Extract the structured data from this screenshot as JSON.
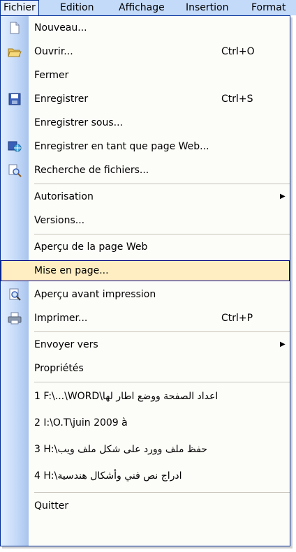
{
  "menubar": {
    "items": [
      {
        "label": "Fichier"
      },
      {
        "label": "Edition"
      },
      {
        "label": "Affichage"
      },
      {
        "label": "Insertion"
      },
      {
        "label": "Format"
      }
    ]
  },
  "menu": {
    "nouveau": {
      "label": "Nouveau...",
      "icon": "new-document-icon"
    },
    "ouvrir": {
      "label": "Ouvrir...",
      "shortcut": "Ctrl+O",
      "icon": "open-folder-icon"
    },
    "fermer": {
      "label": "Fermer"
    },
    "enregistrer": {
      "label": "Enregistrer",
      "shortcut": "Ctrl+S",
      "icon": "save-disk-icon"
    },
    "enregistrer_sous": {
      "label": "Enregistrer sous..."
    },
    "enregistrer_web": {
      "label": "Enregistrer en tant que page Web...",
      "icon": "save-web-icon"
    },
    "recherche": {
      "label": "Recherche de fichiers...",
      "icon": "file-search-icon"
    },
    "autorisation": {
      "label": "Autorisation"
    },
    "versions": {
      "label": "Versions..."
    },
    "apercu_web": {
      "label": "Aperçu de la page Web"
    },
    "mise_en_page": {
      "label": "Mise en page..."
    },
    "apercu_impression": {
      "label": "Aperçu avant impression",
      "icon": "print-preview-icon"
    },
    "imprimer": {
      "label": "Imprimer...",
      "shortcut": "Ctrl+P",
      "icon": "printer-icon"
    },
    "envoyer_vers": {
      "label": "Envoyer vers"
    },
    "proprietes": {
      "label": "Propriétés"
    },
    "recent": [
      {
        "label": "1 F:\\...\\WORD\\اعداد الصفحة ووضع اطار لها"
      },
      {
        "label": "2 I:\\O.T\\juin 2009 à"
      },
      {
        "label": "3 H:\\حفظ ملف وورد على شكل ملف ويب"
      },
      {
        "label": "4 H:\\ادراج نص فني وأشكال هندسية"
      }
    ],
    "quitter": {
      "label": "Quitter"
    }
  },
  "colors": {
    "menubar": "#c3daf9",
    "gutter": "#c2d8f7",
    "highlight": "#ffeec2",
    "highlight_border": "#000080"
  }
}
